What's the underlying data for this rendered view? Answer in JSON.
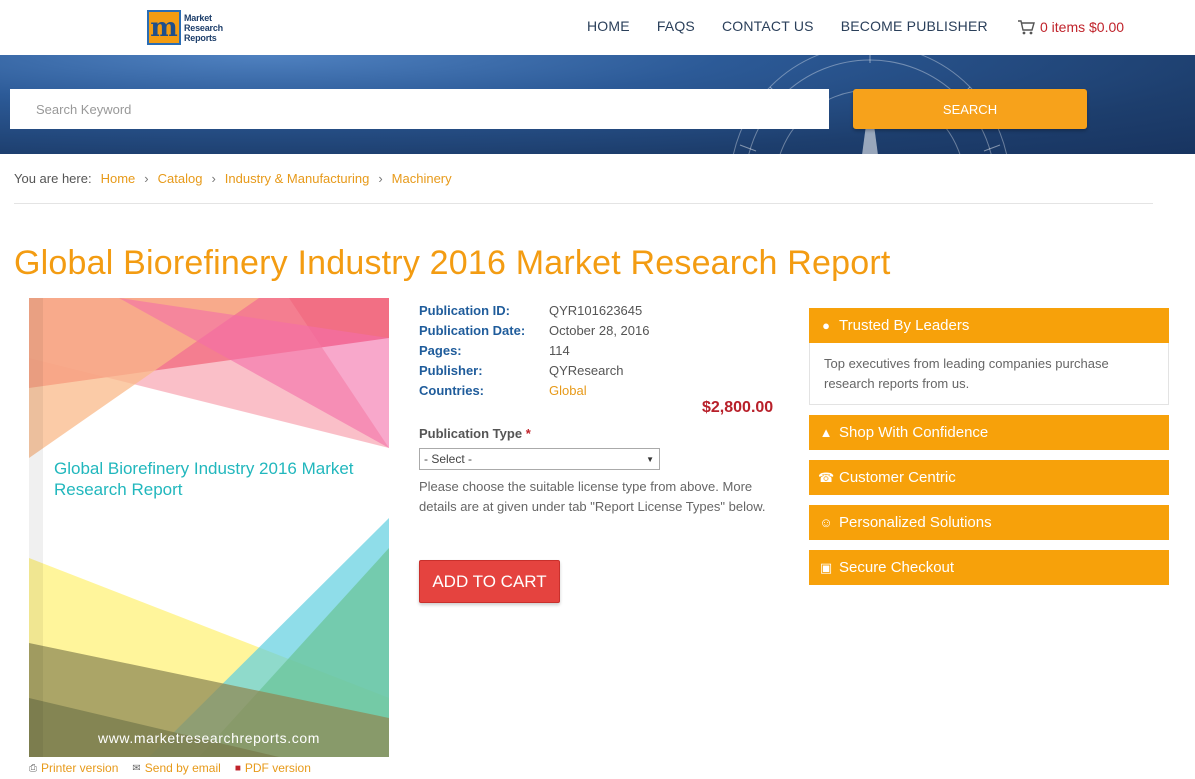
{
  "header": {
    "logo": {
      "mark": "m",
      "line1": "Market",
      "line2": "Research",
      "line3": "Reports"
    },
    "nav": [
      "HOME",
      "FAQS",
      "CONTACT US",
      "BECOME PUBLISHER"
    ],
    "cart_label": "0 items $0.00"
  },
  "search": {
    "placeholder": "Search Keyword",
    "button_label": "SEARCH"
  },
  "breadcrumb": {
    "lead": "You are here:",
    "items": [
      "Home",
      "Catalog",
      "Industry & Manufacturing",
      "Machinery"
    ]
  },
  "page_title": "Global Biorefinery Industry 2016 Market Research Report",
  "cover": {
    "title": "Global Biorefinery Industry 2016 Market Research Report",
    "url": "www.marketresearchreports.com"
  },
  "tools": [
    "Printer version",
    "Send by email",
    "PDF version"
  ],
  "details": [
    {
      "label": "Publication ID:",
      "value": "QYR101623645"
    },
    {
      "label": "Publication Date:",
      "value": "October 28, 2016"
    },
    {
      "label": "Pages:",
      "value": "114"
    },
    {
      "label": "Publisher:",
      "value": "QYResearch"
    },
    {
      "label": "Countries:",
      "value": "Global"
    }
  ],
  "price": "$2,800.00",
  "publication_type": {
    "label": "Publication Type",
    "required_mark": "*",
    "selected": "- Select -"
  },
  "help_text": "Please choose the suitable license type from above. More details are at given under tab \"Report License Types\" below.",
  "add_to_cart_label": "ADD TO CART",
  "panels": [
    {
      "title": "Trusted By Leaders",
      "icon": "users-icon",
      "body": "Top executives from leading companies purchase research reports from us."
    },
    {
      "title": "Shop With Confidence",
      "icon": "thumbs-up-icon"
    },
    {
      "title": "Customer Centric",
      "icon": "phone-icon"
    },
    {
      "title": "Personalized Solutions",
      "icon": "smile-icon"
    },
    {
      "title": "Secure Checkout",
      "icon": "cart-icon"
    }
  ],
  "colors": {
    "accent": "#f7a10a",
    "title": "#f39c12",
    "link": "#e79a1a",
    "label_blue": "#1f5c9b",
    "price": "#b8202a",
    "add_to_cart": "#e5433f",
    "hero": "#1d3e6d"
  }
}
